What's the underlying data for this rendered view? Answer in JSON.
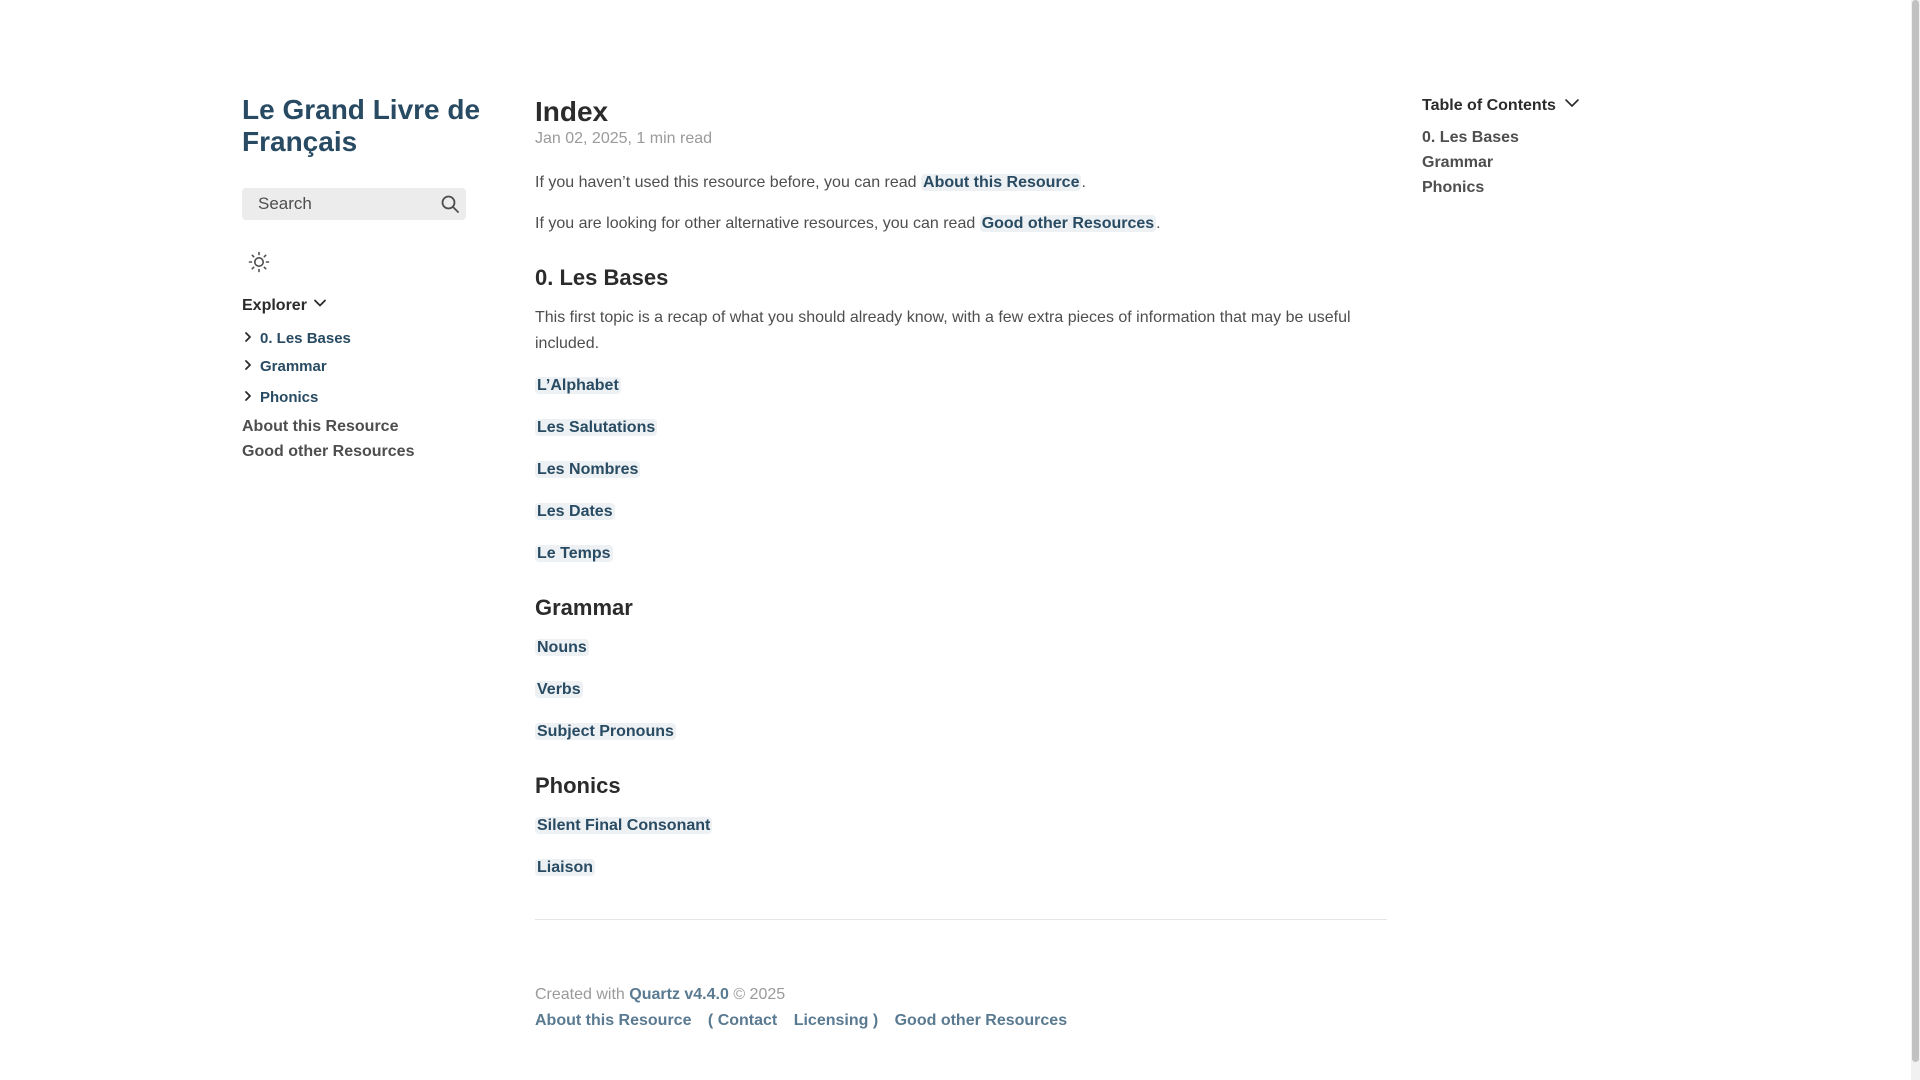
{
  "sidebar": {
    "site_title": "Le Grand Livre de Français",
    "search_label": "Search",
    "explorer_title": "Explorer",
    "folders": [
      "0. Les Bases",
      "Grammar",
      "Phonics"
    ],
    "files": [
      "About this Resource",
      "Good other Resources"
    ]
  },
  "article": {
    "title": "Index",
    "meta": "Jan 02, 2025,  1 min read",
    "intro1_text": "If you haven’t used this resource before, you can read ",
    "intro1_link": "About this Resource",
    "intro2_text": "If you are looking for other alternative resources, you can read ",
    "intro2_link": "Good other Resources",
    "sections": [
      {
        "heading": "0. Les Bases",
        "text": "This first topic is a recap of what you should already know, with a few extra pieces of information that may be useful included.",
        "links": [
          "L’Alphabet",
          "Les Salutations",
          "Les Nombres",
          "Les Dates",
          "Le Temps"
        ]
      },
      {
        "heading": "Grammar",
        "links": [
          "Nouns",
          "Verbs",
          "Subject Pronouns"
        ]
      },
      {
        "heading": "Phonics",
        "links": [
          "Silent Final Consonant",
          "Liaison"
        ]
      }
    ]
  },
  "footer": {
    "created_prefix": "Created with ",
    "quartz_link": "Quartz v4.4.0",
    "copyright": " © 2025",
    "links": [
      "About this Resource",
      "( Contact",
      "Licensing )",
      "Good other Resources"
    ]
  },
  "toc": {
    "title": "Table of Contents",
    "items": [
      "0. Les Bases",
      "Grammar",
      "Phonics"
    ]
  },
  "colors": {
    "accent": "#284b63",
    "text": "#4e4e4e",
    "muted": "#9a9a9a"
  }
}
